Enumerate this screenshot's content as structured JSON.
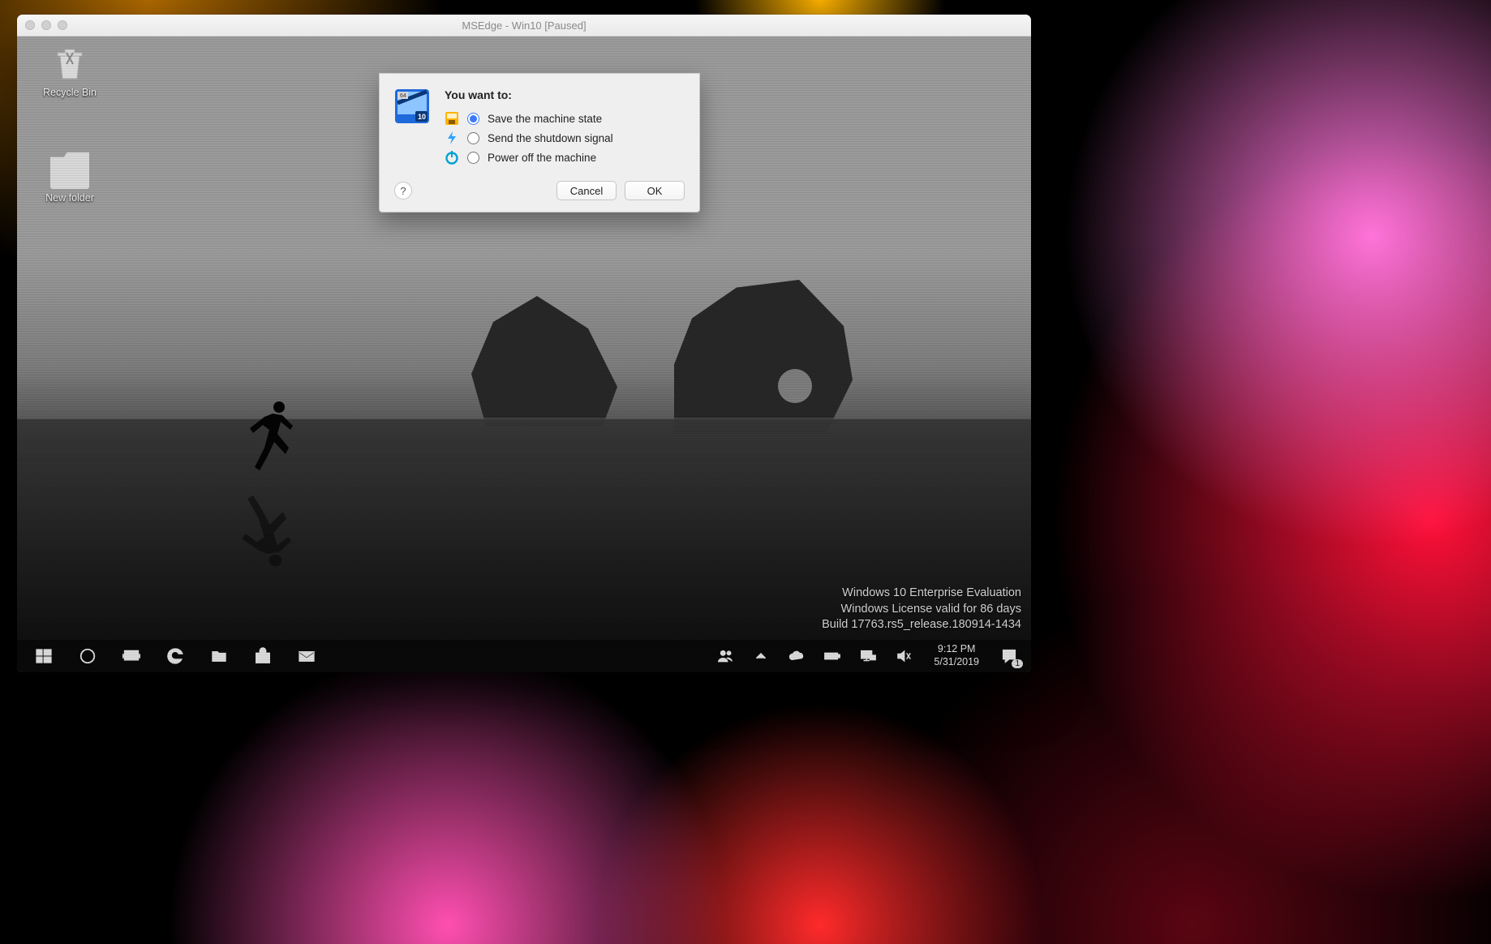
{
  "host_window": {
    "title": "MSEdge - Win10 [Paused]"
  },
  "desktop": {
    "icons": [
      {
        "label": "Recycle Bin"
      },
      {
        "label": "New folder"
      }
    ],
    "watermark": {
      "line1": "Windows 10 Enterprise Evaluation",
      "line2": "Windows License valid for 86 days",
      "line3": "Build 17763.rs5_release.180914-1434"
    }
  },
  "taskbar": {
    "clock_time": "9:12 PM",
    "clock_date": "5/31/2019",
    "action_center_count": "1"
  },
  "dialog": {
    "prompt": "You want to:",
    "options": [
      {
        "label": "Save the machine state"
      },
      {
        "label": "Send the shutdown signal"
      },
      {
        "label": "Power off the machine"
      }
    ],
    "help": "?",
    "cancel": "Cancel",
    "ok": "OK"
  }
}
